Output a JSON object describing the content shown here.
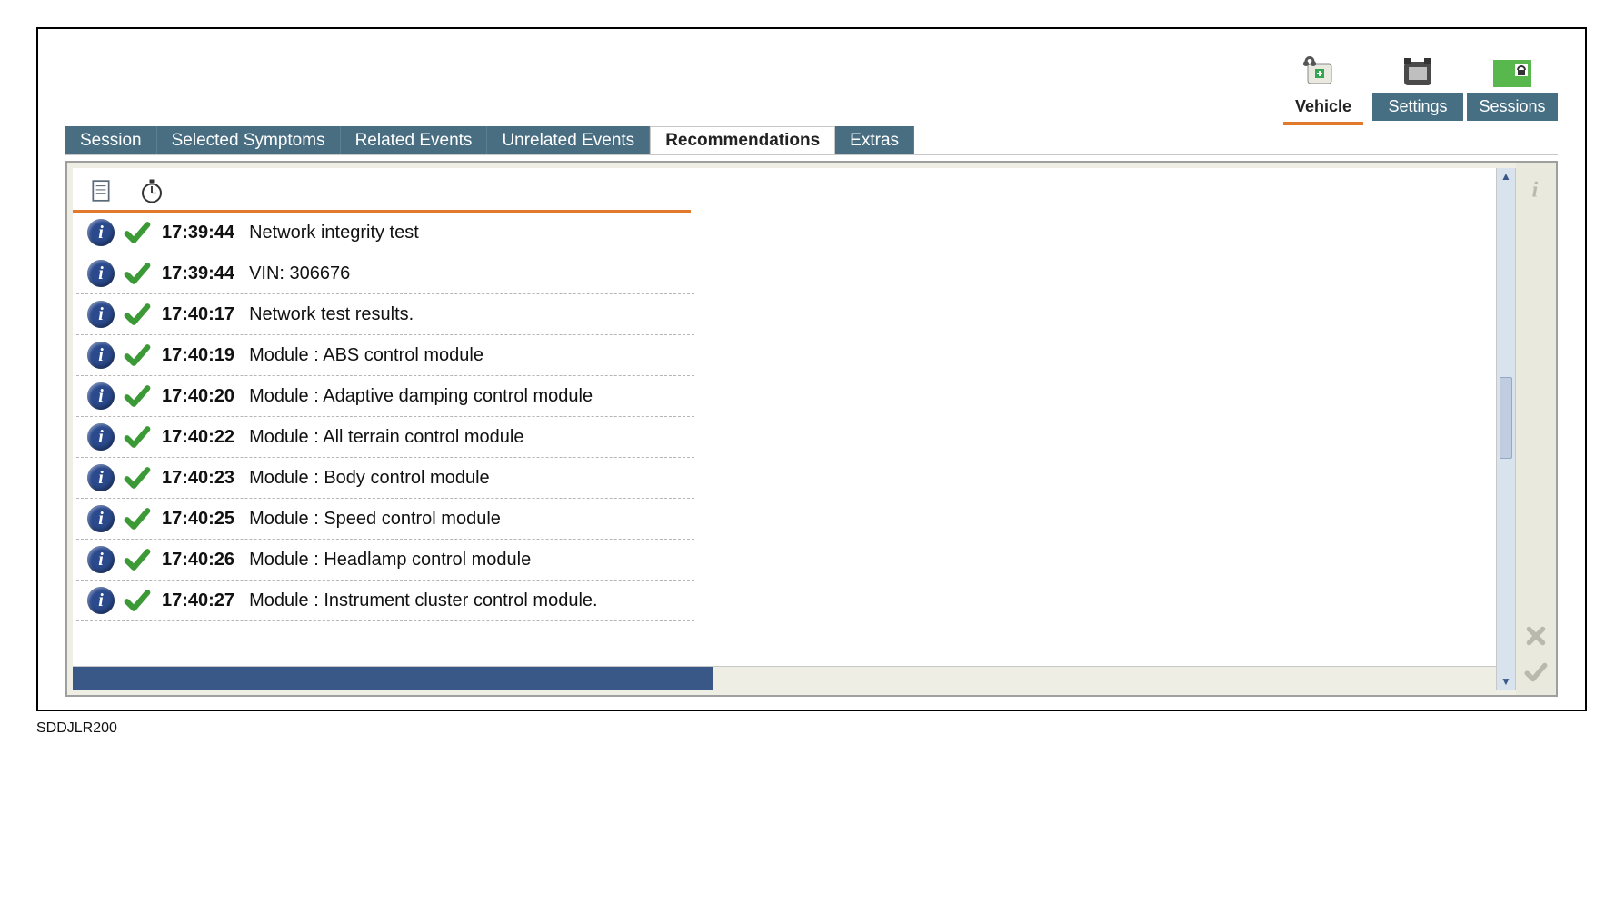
{
  "topbar": {
    "items": [
      {
        "id": "vehicle",
        "label": "Vehicle",
        "active": true
      },
      {
        "id": "settings",
        "label": "Settings",
        "active": false
      },
      {
        "id": "sessions",
        "label": "Sessions",
        "active": false
      }
    ]
  },
  "tabs": {
    "items": [
      {
        "id": "session",
        "label": "Session",
        "active": false
      },
      {
        "id": "selected-symptoms",
        "label": "Selected Symptoms",
        "active": false
      },
      {
        "id": "related-events",
        "label": "Related Events",
        "active": false
      },
      {
        "id": "unrelated-events",
        "label": "Unrelated Events",
        "active": false
      },
      {
        "id": "recommendations",
        "label": "Recommendations",
        "active": true
      },
      {
        "id": "extras",
        "label": "Extras",
        "active": false
      }
    ]
  },
  "list": {
    "rows": [
      {
        "time": "17:39:44",
        "description": "Network integrity test",
        "status": "ok"
      },
      {
        "time": "17:39:44",
        "description": "VIN: 306676",
        "status": "ok"
      },
      {
        "time": "17:40:17",
        "description": "Network test results.",
        "status": "ok"
      },
      {
        "time": "17:40:19",
        "description": "Module : ABS control module",
        "status": "ok"
      },
      {
        "time": "17:40:20",
        "description": "Module : Adaptive damping control module",
        "status": "ok"
      },
      {
        "time": "17:40:22",
        "description": "Module : All terrain control module",
        "status": "ok"
      },
      {
        "time": "17:40:23",
        "description": "Module : Body control module",
        "status": "ok"
      },
      {
        "time": "17:40:25",
        "description": "Module : Speed control module",
        "status": "ok"
      },
      {
        "time": "17:40:26",
        "description": "Module : Headlamp control module",
        "status": "ok"
      },
      {
        "time": "17:40:27",
        "description": "Module : Instrument cluster control module.",
        "status": "ok"
      }
    ]
  },
  "sideTools": {
    "top": [
      "info-icon"
    ],
    "bottom": [
      "close-icon",
      "check-icon"
    ]
  },
  "footer": {
    "label": "SDDJLR200"
  },
  "icons": {
    "info_glyph": "i"
  }
}
